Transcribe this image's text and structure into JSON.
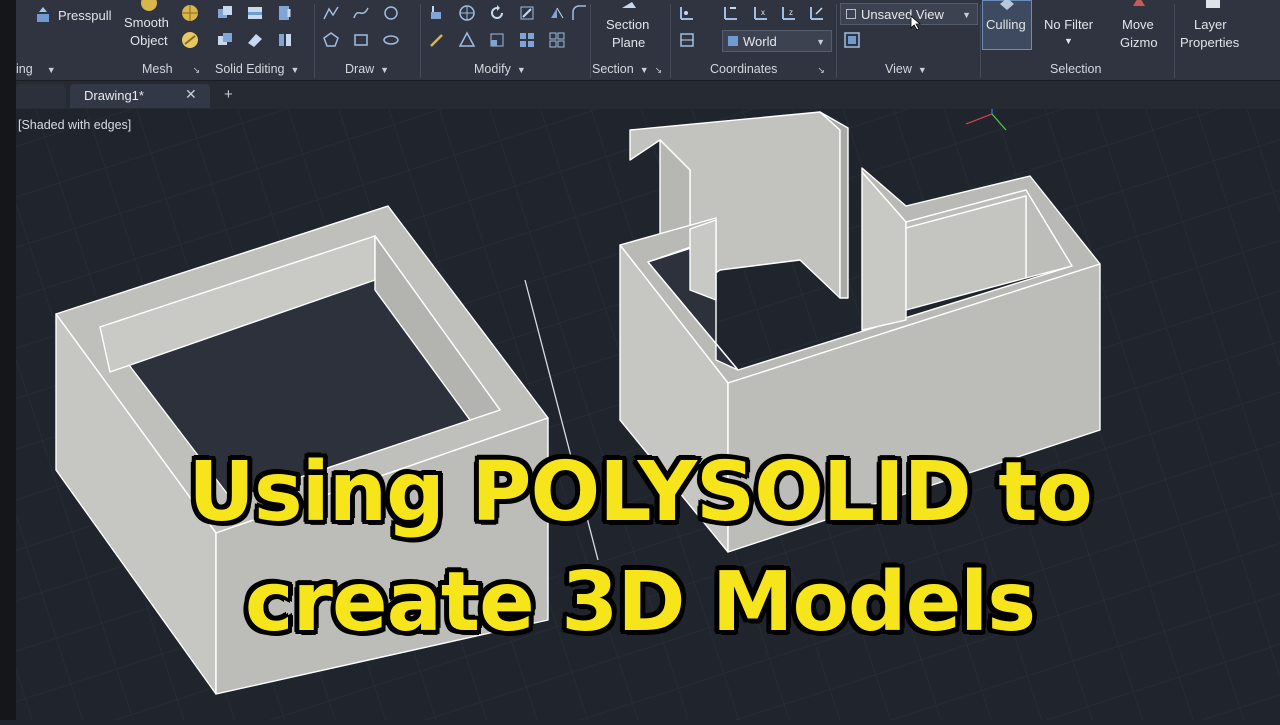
{
  "ribbon": {
    "presspull": "Presspull",
    "smooth_object_1": "Smooth",
    "smooth_object_2": "Object",
    "section_plane_1": "Section",
    "section_plane_2": "Plane",
    "culling": "Culling",
    "no_filter": "No Filter",
    "move_gizmo_1": "Move",
    "move_gizmo_2": "Gizmo",
    "layer_properties_1": "Layer",
    "layer_properties_2": "Properties",
    "view_combo": "Unsaved View",
    "coord_combo": "World",
    "panels": {
      "modeling": "ing",
      "mesh": "Mesh",
      "solid_editing": "Solid Editing",
      "draw": "Draw",
      "modify": "Modify",
      "section": "Section",
      "coordinates": "Coordinates",
      "view": "View",
      "selection": "Selection"
    }
  },
  "tabs": {
    "drawing": "Drawing1*",
    "close": "✕",
    "add": "+"
  },
  "viewport": {
    "visual_style": "[Shaded with edges]"
  },
  "caption": {
    "line1": "Using POLYSOLID to",
    "line2": "create 3D Models"
  },
  "colors": {
    "caption": "#f7e51c",
    "solid_face": "#c4c4c0",
    "solid_top": "#b9b9b5",
    "background": "#20242d"
  }
}
